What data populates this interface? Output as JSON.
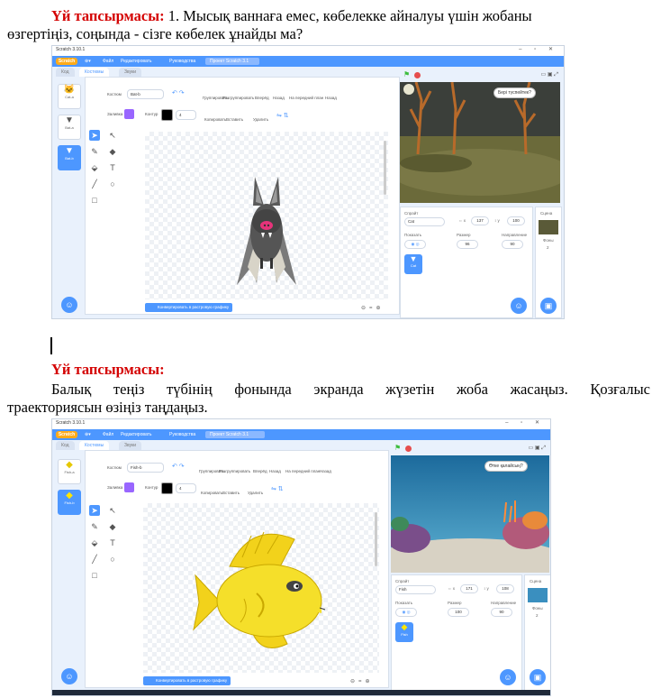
{
  "task1": {
    "heading": "Үй тапсырмасы:",
    "line1": " 1. Мысық ваннаға емес, көбелекке айналуы үшін жобаны",
    "line2": "өзгертіңіз, соңында - сізге көбелек ұнайды ма?"
  },
  "task2": {
    "heading": "Үй тапсырмасы:",
    "line1": "Балық теңіз түбінің фонында экранда жүзетін жоба жасаңыз. Қозғалыс",
    "line2": "траекториясын өзіңіз таңдаңыз."
  },
  "scratch1": {
    "window_title": "Scratch 3.10.1",
    "logo": "Scratch",
    "menu": [
      "Файл",
      "Редактировать",
      "Руководства"
    ],
    "project_title": "Проект Scratch 3.1",
    "tabs": [
      "Код",
      "Костюмы",
      "Звуки"
    ],
    "costume_label": "Костюм",
    "costume_name": "Bat-b",
    "fill_label": "Заливка",
    "outline_label": "Контур",
    "outline_width": "4",
    "toolbar": [
      "Группировать",
      "Разгруппировать",
      "Вперёд",
      "Назад",
      "На передний план",
      "Назад"
    ],
    "copy": "Копировать",
    "paste": "Вставить",
    "delete": "Удалить",
    "convert_button": "Конвертировать в растровую графику",
    "speech": "Бері түспейтек?",
    "sprite_label": "Спрайт",
    "sprite_name": "Cat",
    "x": "137",
    "y": "100",
    "show_label": "Показать",
    "size_label": "Размер",
    "size": "96",
    "direction_label": "Направление",
    "direction": "90",
    "stage_label": "Сцена",
    "backdrops_label": "Фоны",
    "backdrops_count": "2",
    "costumes": [
      {
        "name": "Cat-a",
        "size": "96 x 101"
      },
      {
        "name": "Bat-a",
        "size": "105 x 92"
      },
      {
        "name": "Bat-b",
        "size": "105 x 87"
      }
    ],
    "sprite_tile": "Cat",
    "fill_color": "#9966ff",
    "outline_color": "#000000"
  },
  "scratch2": {
    "window_title": "Scratch 3.10.1",
    "logo": "Scratch",
    "menu": [
      "Файл",
      "Редактировать",
      "Руководства"
    ],
    "project_title": "Проект Scratch 3.1",
    "tabs": [
      "Код",
      "Костюмы",
      "Звуки"
    ],
    "costume_label": "Костюм",
    "costume_name": "Fish-b",
    "fill_label": "Заливка",
    "outline_label": "Контур",
    "outline_width": "4",
    "toolbar": [
      "Группировать",
      "Разгруппировать",
      "Вперёд",
      "Назад",
      "На передний план",
      "Назад"
    ],
    "copy": "Копировать",
    "paste": "Вставить",
    "delete": "Удалить",
    "convert_button": "Конвертировать в растровую графику",
    "speech": "Өтке қалайсың?",
    "sprite_label": "Спрайт",
    "sprite_name": "Fish",
    "x": "171",
    "y": "108",
    "show_label": "Показать",
    "size_label": "Размер",
    "size": "100",
    "direction_label": "Направление",
    "direction": "90",
    "stage_label": "Сцена",
    "backdrops_label": "Фоны",
    "backdrops_count": "2",
    "costumes": [
      {
        "name": "Fish-a",
        "size": "128 x 70"
      },
      {
        "name": "Fish-b",
        "size": "161 x 99"
      }
    ],
    "sprite_tile": "Fish",
    "fill_color": "#9966ff",
    "outline_color": "#000000"
  }
}
